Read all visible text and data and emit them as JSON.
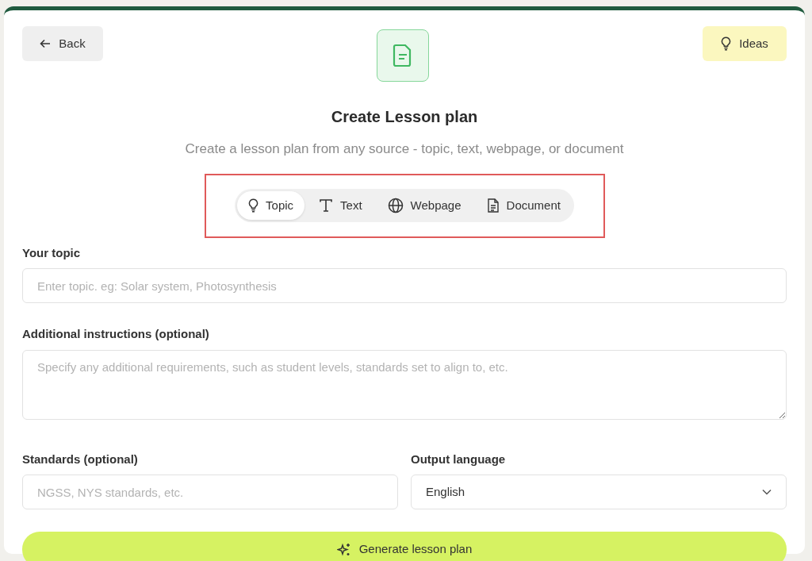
{
  "header": {
    "back_label": "Back",
    "ideas_label": "Ideas",
    "title": "Create Lesson plan",
    "subtitle": "Create a lesson plan from any source - topic, text, webpage, or document"
  },
  "source_tabs": {
    "highlighted": true,
    "tabs": [
      {
        "kind": "topic",
        "label": "Topic",
        "selected": true
      },
      {
        "kind": "text",
        "label": "Text",
        "selected": false
      },
      {
        "kind": "webpage",
        "label": "Webpage",
        "selected": false
      },
      {
        "kind": "document",
        "label": "Document",
        "selected": false
      }
    ]
  },
  "topic": {
    "label": "Your topic",
    "placeholder": "Enter topic. eg: Solar system, Photosynthesis"
  },
  "instructions": {
    "label": "Additional instructions (optional)",
    "placeholder": "Specify any additional requirements, such as student levels, standards set to align to, etc."
  },
  "standards": {
    "label": "Standards (optional)",
    "placeholder": "NGSS, NYS standards, etc."
  },
  "output_language": {
    "label": "Output language",
    "value": "English"
  },
  "generate_button": "Generate lesson plan"
}
